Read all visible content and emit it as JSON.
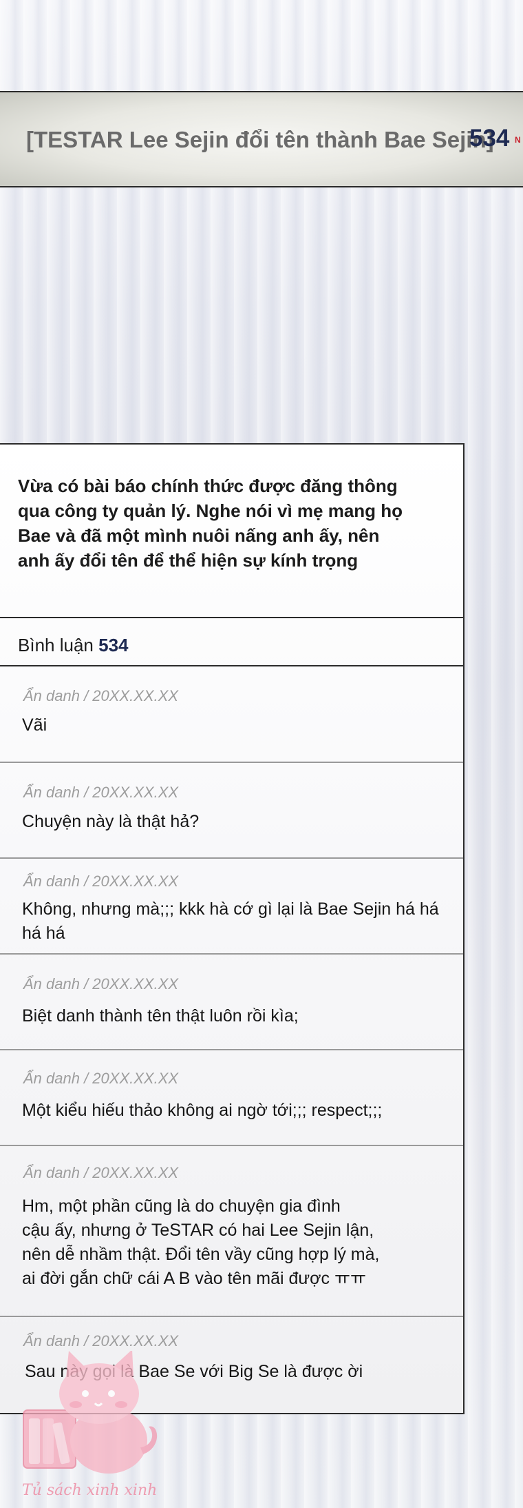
{
  "post": {
    "title": "[TESTAR Lee Sejin đổi tên thành Bae Sejin]",
    "comment_count": "534",
    "new_badge": "N"
  },
  "article": {
    "lines": [
      "Vừa có bài báo chính thức được đăng thông",
      "qua công ty quản lý. Nghe nói vì mẹ mang họ",
      "Bae và đã một mình nuôi nấng anh ấy, nên",
      "anh ấy đổi tên để thể hiện sự kính trọng"
    ]
  },
  "comments_section": {
    "label": "Bình luận",
    "count": "534"
  },
  "comments": [
    {
      "meta": "Ẩn danh  / 20XX.XX.XX",
      "lines": [
        "Vãi"
      ]
    },
    {
      "meta": "Ẩn danh  / 20XX.XX.XX",
      "lines": [
        "Chuyện này là thật hả?"
      ]
    },
    {
      "meta": "Ẩn danh  / 20XX.XX.XX",
      "lines": [
        "Không, nhưng mà;;; kkk hà cớ gì lại là Bae Sejin há há",
        "há há"
      ]
    },
    {
      "meta": "Ẩn danh  / 20XX.XX.XX",
      "lines": [
        "Biệt danh thành tên thật luôn rồi kìa;"
      ]
    },
    {
      "meta": "Ẩn danh  / 20XX.XX.XX",
      "lines": [
        "Một kiểu hiếu thảo không ai ngờ tới;;; respect;;;"
      ]
    },
    {
      "meta": "Ẩn danh  / 20XX.XX.XX",
      "lines": [
        "Hm, một phần cũng là do chuyện gia đình",
        "cậu ấy, nhưng ở TeSTAR có hai Lee Sejin lận,",
        "nên dễ nhầm thật. Đổi tên vầy cũng hợp lý mà,",
        "ai đời gắn chữ cái A B vào tên mãi được ㅠㅠ"
      ]
    },
    {
      "meta": "Ẩn danh  / 20XX.XX.XX",
      "lines": [
        "Sau này gọi là Bae Se với Big Se là được ời"
      ]
    }
  ],
  "watermark": {
    "text": "Tủ sách xinh xinh",
    "icon": "pink-cat-bookshelf-logo"
  },
  "colors": {
    "accent_navy": "#1e2a52",
    "new_badge_red": "#c81f2b",
    "meta_gray": "#9d9d9d",
    "watermark_pink": "#ee8ea5"
  }
}
